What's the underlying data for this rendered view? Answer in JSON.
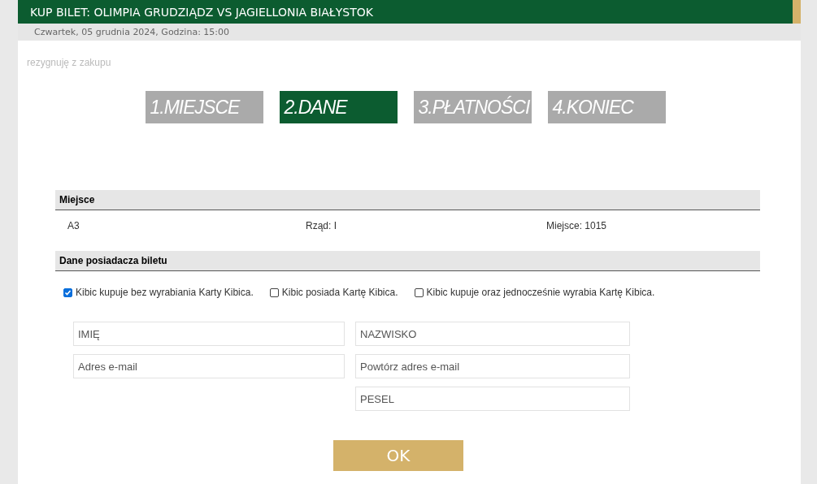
{
  "header": {
    "title": "KUP BILET: OLIMPIA GRUDZIĄDZ VS JAGIELLONIA BIAŁYSTOK",
    "subtitle": "Czwartek, 05 grudnia 2024, Godzina: 15:00"
  },
  "cancel_link": "rezygnuję z zakupu",
  "steps": [
    {
      "label": "1.MIEJSCE",
      "selected": false
    },
    {
      "label": "2.DANE",
      "selected": true
    },
    {
      "label": "3.PŁATNOŚCI",
      "selected": false
    },
    {
      "label": "4.KONIEC",
      "selected": false
    }
  ],
  "seat_section": {
    "title": "Miejsce",
    "values": [
      "A3",
      "Rząd: I",
      "Miejsce: 1015"
    ]
  },
  "holder_section": {
    "title": "Dane posiadacza biletu",
    "options": [
      {
        "label": "Kibic kupuje bez wyrabiania Karty Kibica.",
        "checked": true
      },
      {
        "label": "Kibic posiada Kartę Kibica.",
        "checked": false
      },
      {
        "label": "Kibic kupuje oraz jednocześnie wyrabia Kartę Kibica.",
        "checked": false
      }
    ],
    "field_columns": [
      [
        {
          "placeholder": "IMIĘ"
        },
        {
          "placeholder": "Adres e-mail"
        }
      ],
      [
        {
          "placeholder": "NAZWISKO"
        },
        {
          "placeholder": "Powtórz adres e-mail"
        },
        {
          "placeholder": "PESEL"
        }
      ]
    ]
  },
  "submit_button": "OK"
}
